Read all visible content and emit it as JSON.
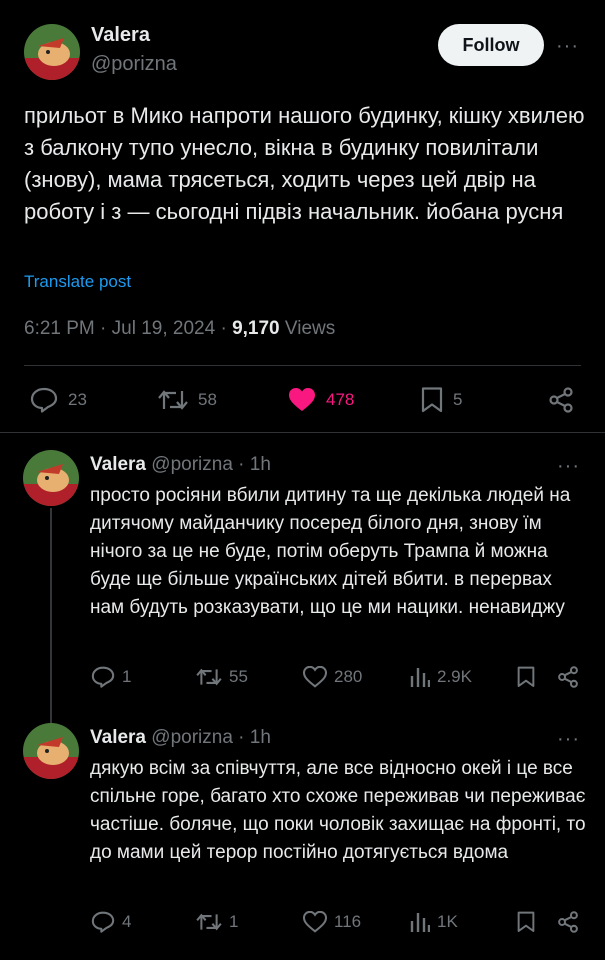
{
  "main": {
    "name": "Valera",
    "handle": "@porizna",
    "follow_label": "Follow",
    "more": "···",
    "text": "прильот в Мико напроти нашого будинку, кішку хвилею з балкону тупо унесло, вікна в будинку повилітали (знову), мама трясеться, ходить через цей двір на роботу і з — сьогодні підвіз начальник. йобана русня",
    "translate": "Translate post",
    "time": "6:21 PM",
    "date": "Jul 19, 2024",
    "views_count": "9,170",
    "views_label": "Views",
    "replies": "23",
    "reposts": "58",
    "likes": "478",
    "bookmarks": "5",
    "like_color": "#f91880"
  },
  "replies": [
    {
      "name": "Valera",
      "handle": "@porizna",
      "time": "· 1h",
      "more": "···",
      "text": "просто росіяни вбили дитину та ще декілька людей на дитячому майданчику посеред білого дня, знову їм нічого за це не буде, потім оберуть Трампа й можна буде ще більше українських дітей вбити. в перервах нам будуть розказувати, що це ми нацики. ненавиджу",
      "replies": "1",
      "reposts": "55",
      "likes": "280",
      "views": "2.9K"
    },
    {
      "name": "Valera",
      "handle": "@porizna",
      "time": "· 1h",
      "more": "···",
      "text": "дякую всім за співчуття, але все відносно окей і це все спільне горе, багато хто схоже переживав чи переживає частіше. боляче, що поки чоловік захищає на фронті, то до мами цей терор постійно дотягується вдома",
      "replies": "4",
      "reposts": "1",
      "likes": "116",
      "views": "1K"
    }
  ]
}
